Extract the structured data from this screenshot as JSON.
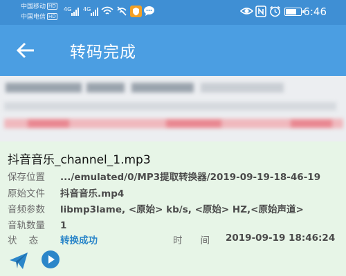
{
  "status_bar": {
    "carrier1": "中国移动",
    "carrier2": "中国电信",
    "hd_badge": "HD",
    "network1": "4G",
    "network2": "4G",
    "time": "6:46",
    "battery_level": 0.75,
    "icons": [
      "wifi-icon",
      "wifi-off-icon",
      "vpn-shield-icon",
      "chat-bubble-icon",
      "eye-icon",
      "nfc-icon",
      "alarm-icon",
      "battery-icon"
    ]
  },
  "app_bar": {
    "back_icon": "arrow-left-icon",
    "title": "转码完成"
  },
  "result": {
    "file_name": "抖音音乐_channel_1.mp3",
    "rows": [
      {
        "label": "保存位置",
        "value": ".../emulated/0/MP3提取转换器/2019-09-19-18-46-19"
      },
      {
        "label": "原始文件",
        "value": "抖音音乐.mp4"
      },
      {
        "label": "音频参数",
        "value": "libmp3lame, <原始> kb/s, <原始> HZ,<原始声道>"
      },
      {
        "label": "音轨数量",
        "value": "1"
      }
    ],
    "status_label": "状    态",
    "status_value": "转换成功",
    "time_label": "时间",
    "time_value": "2019-09-19 18:46:24"
  },
  "actions": {
    "share_icon": "paper-plane-icon",
    "play_icon": "play-circle-icon"
  },
  "colors": {
    "status_bar": "#3f8fd4",
    "app_bar": "#4b9ee2",
    "info_background": "#e7f5e7",
    "accent_blue": "#2b86c9"
  }
}
